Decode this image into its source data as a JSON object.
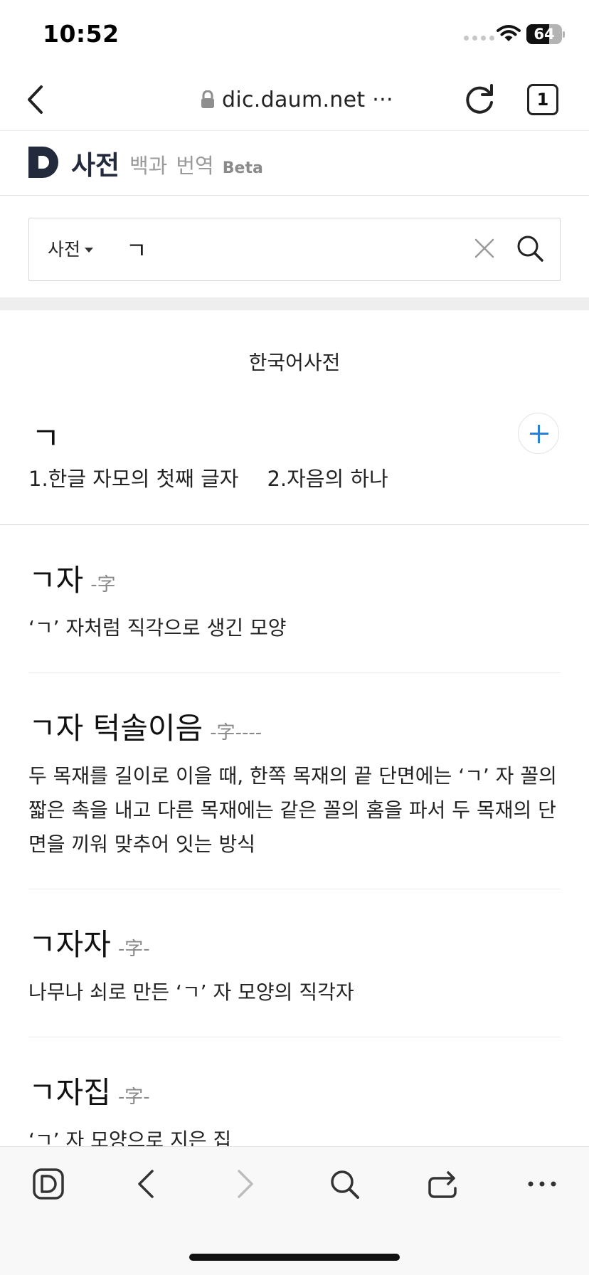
{
  "status": {
    "time": "10:52",
    "battery": "64",
    "battery_level": 0.64
  },
  "browser": {
    "url": "dic.daum.net ···",
    "tab_count": "1"
  },
  "site": {
    "logo": "사전",
    "nav": [
      "백과",
      "번역"
    ],
    "beta": "Beta"
  },
  "search": {
    "category": "사전",
    "query": "ㄱ"
  },
  "section_title": "한국어사전",
  "main_entry": {
    "word": "ㄱ",
    "senses": [
      "1.한글 자모의 첫째 글자",
      "2.자음의 하나"
    ]
  },
  "results": [
    {
      "word": "ㄱ자",
      "hanja": "-字",
      "definition": "‘ㄱ’ 자처럼 직각으로 생긴 모양"
    },
    {
      "word": "ㄱ자 턱솔이음",
      "hanja": "-字----",
      "definition": "두 목재를 길이로 이을 때, 한쪽 목재의 끝 단면에는 ‘ㄱ’ 자 꼴의 짧은 촉을 내고 다른 목재에는 같은 꼴의 홈을 파서 두 목재의 단면을 끼워 맞추어 잇는 방식"
    },
    {
      "word": "ㄱ자자",
      "hanja": "-字-",
      "definition": "나무나 쇠로 만든 ‘ㄱ’ 자 모양의 직각자"
    },
    {
      "word": "ㄱ자집",
      "hanja": "-字-",
      "definition": "‘ㄱ’ 자 모양으로 지은 집"
    }
  ]
}
